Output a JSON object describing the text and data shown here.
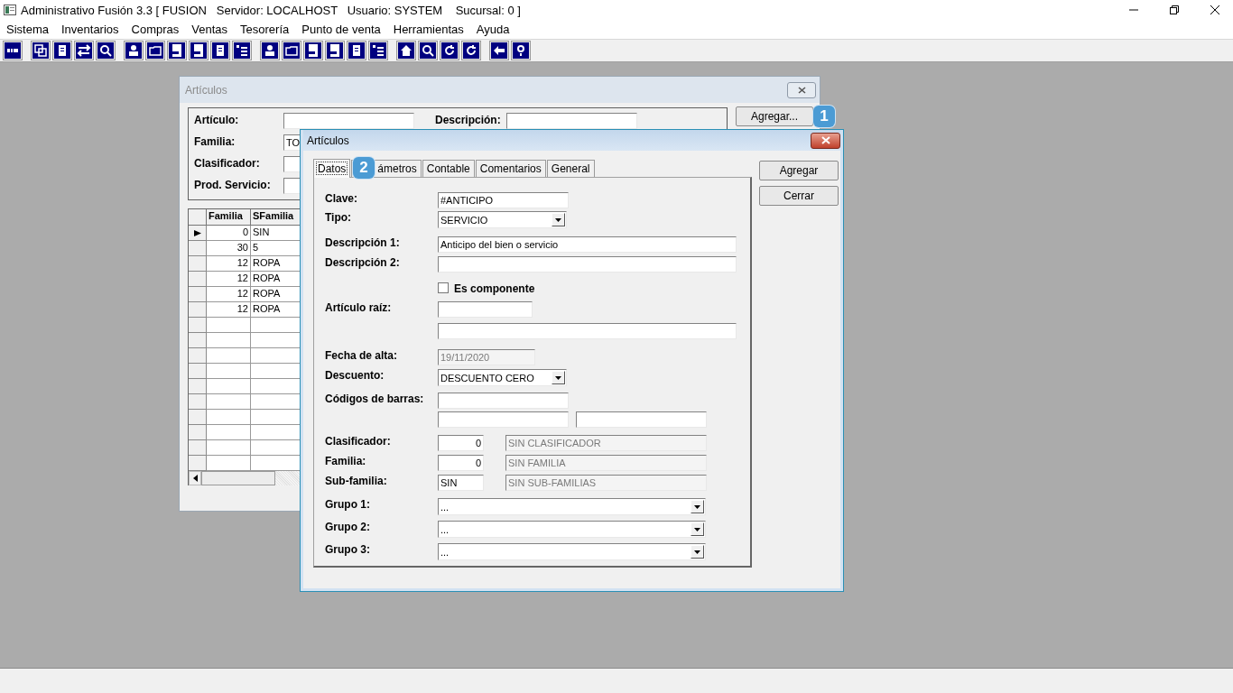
{
  "app_window": {
    "title": "Administrativo Fusión 3.3 [ FUSION   Servidor: LOCALHOST   Usuario: SYSTEM    Sucursal: 0 ]"
  },
  "menu": [
    "Sistema",
    "Inventarios",
    "Compras",
    "Ventas",
    "Tesorería",
    "Punto de venta",
    "Herramientas",
    "Ayuda"
  ],
  "back_window": {
    "title": "Artículos",
    "active": false,
    "filters": [
      {
        "label": "Artículo:"
      },
      {
        "label": "Familia:",
        "value": "TO"
      },
      {
        "label": "Clasificador:"
      },
      {
        "label": "Prod. Servicio:"
      }
    ],
    "description": {
      "label": "Descripción:"
    },
    "add_button": {
      "label": "Agregar...",
      "badge": "1"
    },
    "grid": {
      "columns": [
        "Familia",
        "SFamilia"
      ],
      "rows": [
        {
          "familia": "0",
          "sfamilia": "SIN",
          "selected": true
        },
        {
          "familia": "30",
          "sfamilia": "5",
          "selected": false
        },
        {
          "familia": "12",
          "sfamilia": "ROPA",
          "selected": false
        },
        {
          "familia": "12",
          "sfamilia": "ROPA",
          "selected": false
        },
        {
          "familia": "12",
          "sfamilia": "ROPA",
          "selected": false
        },
        {
          "familia": "12",
          "sfamilia": "ROPA",
          "selected": false
        }
      ]
    }
  },
  "front_window": {
    "title": "Artículos",
    "active": true,
    "tabs": [
      {
        "label": "Datos",
        "selected": true
      },
      {
        "label": "ámetros",
        "selected": false,
        "badge": "2"
      },
      {
        "label": "Contable",
        "selected": false
      },
      {
        "label": "Comentarios",
        "selected": false
      },
      {
        "label": "General",
        "selected": false
      }
    ],
    "buttons": [
      "Agregar",
      "Cerrar"
    ],
    "form": {
      "clave": {
        "label": "Clave:",
        "value": "#ANTICIPO"
      },
      "tipo": {
        "label": "Tipo:",
        "value": "SERVICIO"
      },
      "descripcion_1": {
        "label": "Descripción 1:",
        "value": "Anticipo del bien o servicio"
      },
      "descripcion_2": {
        "label": "Descripción 2:"
      },
      "es_componente": {
        "label": "Es componente",
        "checked": false
      },
      "articulo_raiz": {
        "label": "Artículo raíz:"
      },
      "fecha_alta": {
        "label": "Fecha de alta:",
        "value": "19/11/2020",
        "disabled": true
      },
      "descuento": {
        "label": "Descuento:",
        "value": "DESCUENTO CERO"
      },
      "codigos_barras": {
        "label": "Códigos de barras:"
      },
      "catalogs": [
        {
          "label": "Clasificador:",
          "code": "0",
          "name": "SIN CLASIFICADOR",
          "kind": "numeric"
        },
        {
          "label": "Familia:",
          "code": "0",
          "name": "SIN FAMILIA",
          "kind": "numeric"
        },
        {
          "label": "Sub-familia:",
          "code": "SIN",
          "name": "SIN SUB-FAMILIAS",
          "kind": "text"
        }
      ],
      "grupos": [
        {
          "label": "Grupo 1:",
          "value": "..."
        },
        {
          "label": "Grupo 2:",
          "value": "..."
        },
        {
          "label": "Grupo 3:",
          "value": "..."
        }
      ]
    }
  }
}
